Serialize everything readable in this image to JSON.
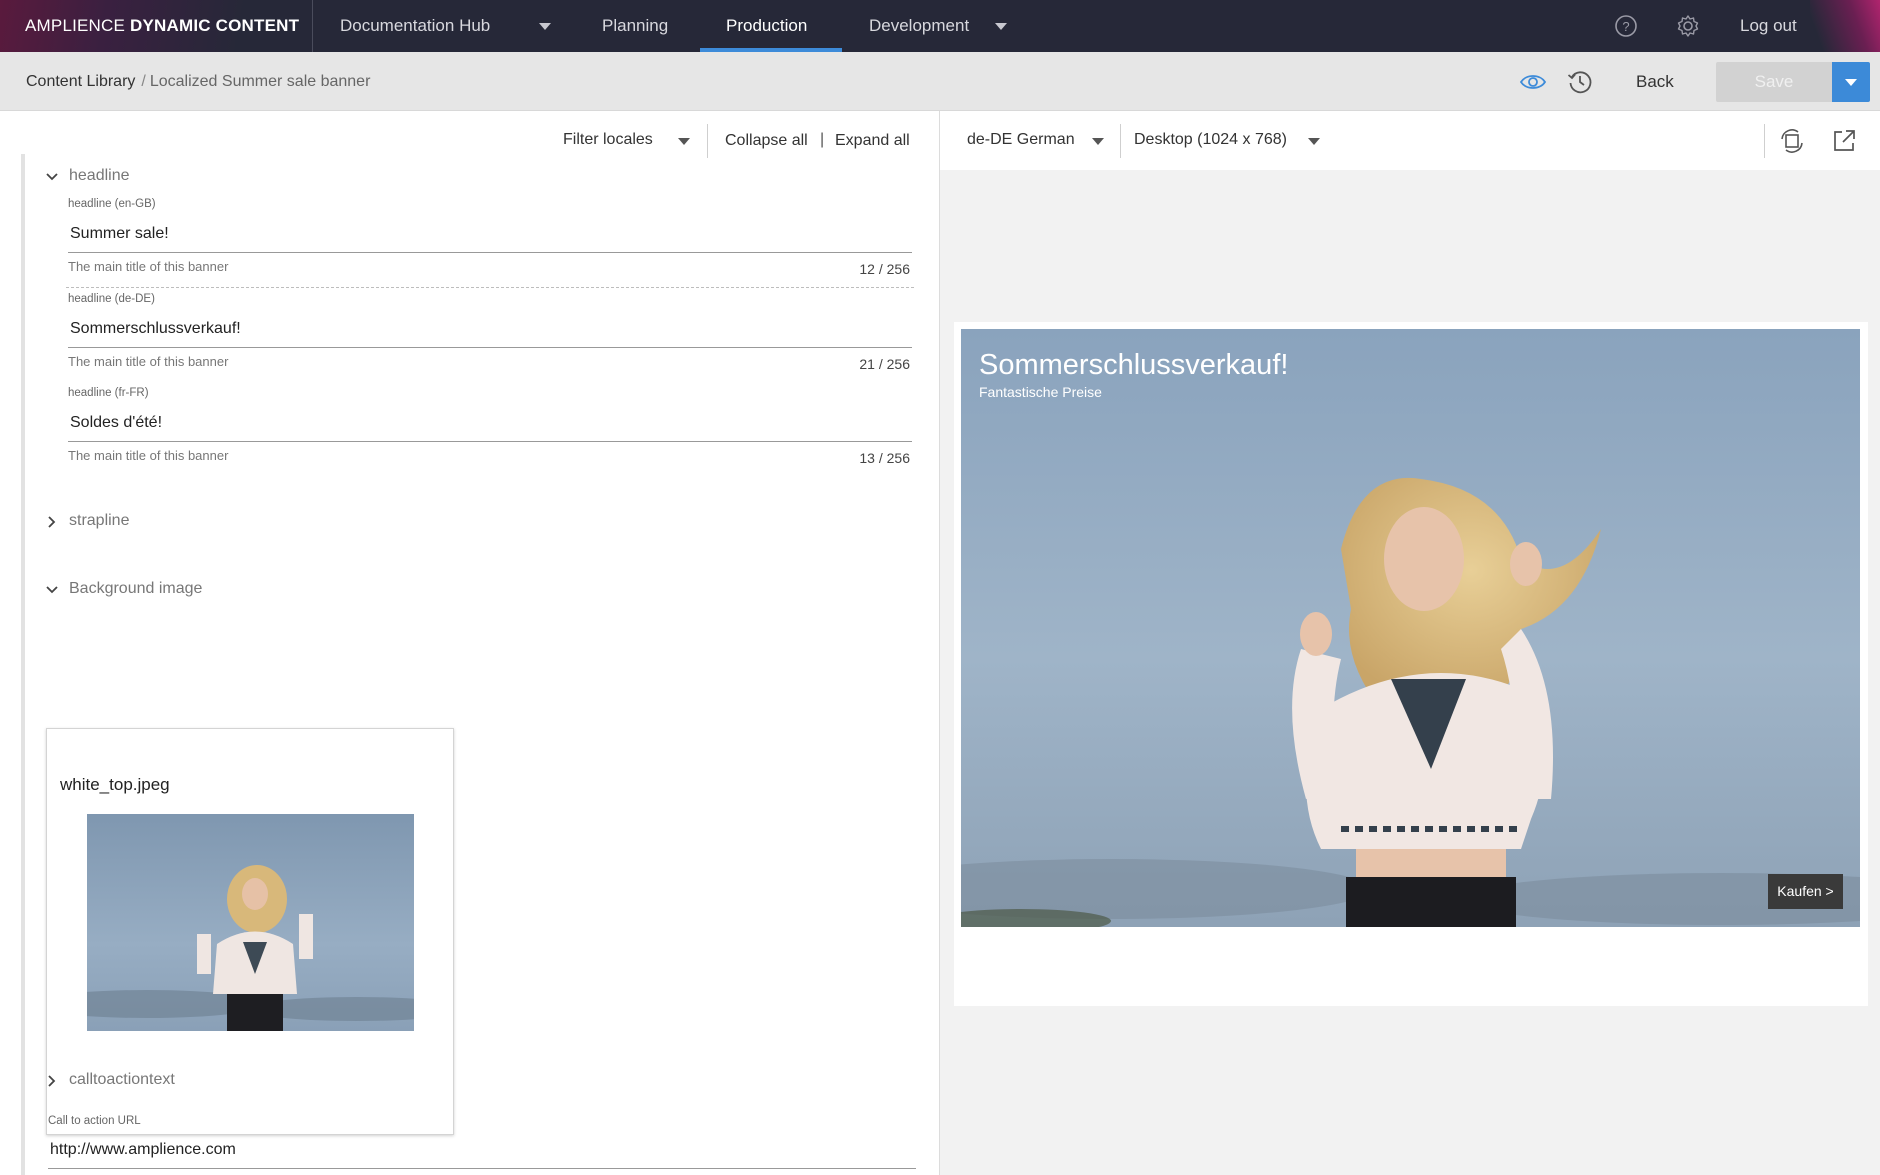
{
  "topnav": {
    "brand_light": "AMPLIENCE",
    "brand_bold": "DYNAMIC CONTENT",
    "hub": "Documentation Hub",
    "tabs": [
      "Planning",
      "Production",
      "Development"
    ],
    "active_tab": "Production",
    "logout": "Log out"
  },
  "subheader": {
    "breadcrumb_root": "Content Library",
    "breadcrumb_separator": "/",
    "breadcrumb_leaf": "Localized Summer sale banner",
    "back": "Back",
    "save": "Save"
  },
  "editor_toolbar": {
    "filter_locales": "Filter locales",
    "collapse_all": "Collapse all",
    "divider": "|",
    "expand_all": "Expand all"
  },
  "sections": {
    "headline": {
      "title": "headline",
      "fields": [
        {
          "label": "headline (en-GB)",
          "value": "Summer sale!",
          "help": "The main title of this banner",
          "count": "12 / 256"
        },
        {
          "label": "headline (de-DE)",
          "value": "Sommerschlussverkauf!",
          "help": "The main title of this banner",
          "count": "21 / 256"
        },
        {
          "label": "headline (fr-FR)",
          "value": "Soldes d'été!",
          "help": "The main title of this banner",
          "count": "13 / 256"
        }
      ]
    },
    "strapline": {
      "title": "strapline"
    },
    "background_image": {
      "title": "Background image",
      "filename": "white_top.jpeg"
    },
    "calltoactiontext": {
      "title": "calltoactiontext"
    },
    "cta_url": {
      "label": "Call to action URL",
      "value": "http://www.amplience.com"
    }
  },
  "preview": {
    "locale": "de-DE German",
    "viewport": "Desktop (1024 x 768)",
    "banner_title": "Sommerschlussverkauf!",
    "banner_subtitle": "Fantastische Preise",
    "banner_button": "Kaufen >"
  },
  "colors": {
    "nav_bg": "#262838",
    "accent": "#3d8bd9",
    "sky": "#8ea7bf"
  },
  "icons": [
    "help-icon",
    "settings-icon",
    "eye-icon",
    "history-icon",
    "chevron-down-icon",
    "chevron-right-icon",
    "rotate-icon",
    "open-external-icon"
  ]
}
